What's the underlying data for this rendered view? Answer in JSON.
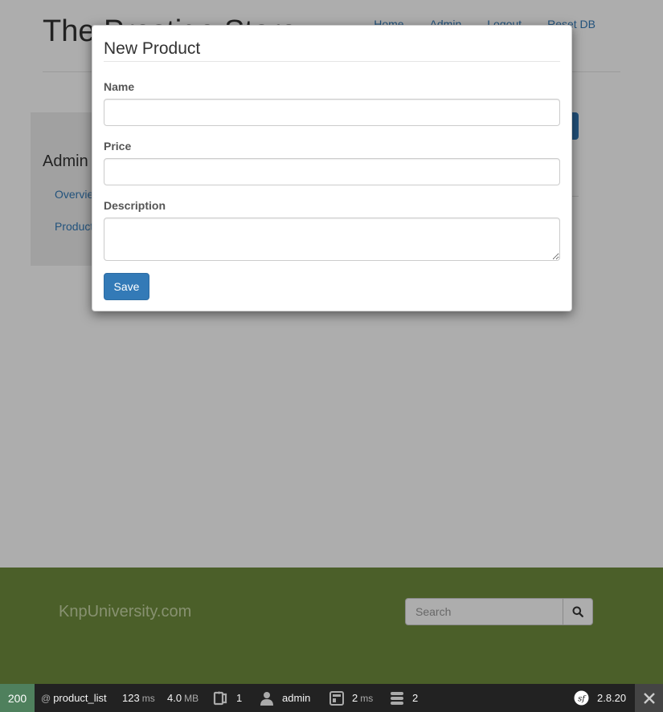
{
  "header": {
    "brand": "The Prestige Store",
    "nav": [
      "Home",
      "Admin",
      "Logout",
      "Reset DB"
    ]
  },
  "sidebar": {
    "title": "Admin",
    "items": [
      "Overview",
      "Products"
    ]
  },
  "modal": {
    "title": "New Product",
    "fields": {
      "name_label": "Name",
      "name_value": "",
      "price_label": "Price",
      "price_value": "",
      "description_label": "Description",
      "description_value": ""
    },
    "save_label": "Save"
  },
  "footer": {
    "brand": "KnpUniversity.com",
    "search_placeholder": "Search",
    "search_icon": "search-icon"
  },
  "toolbar": {
    "status_code": "200",
    "route_prefix": "@",
    "route": "product_list",
    "time_value": "123",
    "time_unit": "ms",
    "memory_value": "4.0",
    "memory_unit": "MB",
    "forms_count": "1",
    "user": "admin",
    "render_value": "2",
    "render_unit": "ms",
    "db_queries": "2",
    "version": "2.8.20",
    "colors": {
      "status_ok": "#4f805d",
      "bar_bg": "#222222"
    }
  },
  "colors": {
    "primary": "#337ab7",
    "footer_bg": "#6f8d3d"
  }
}
